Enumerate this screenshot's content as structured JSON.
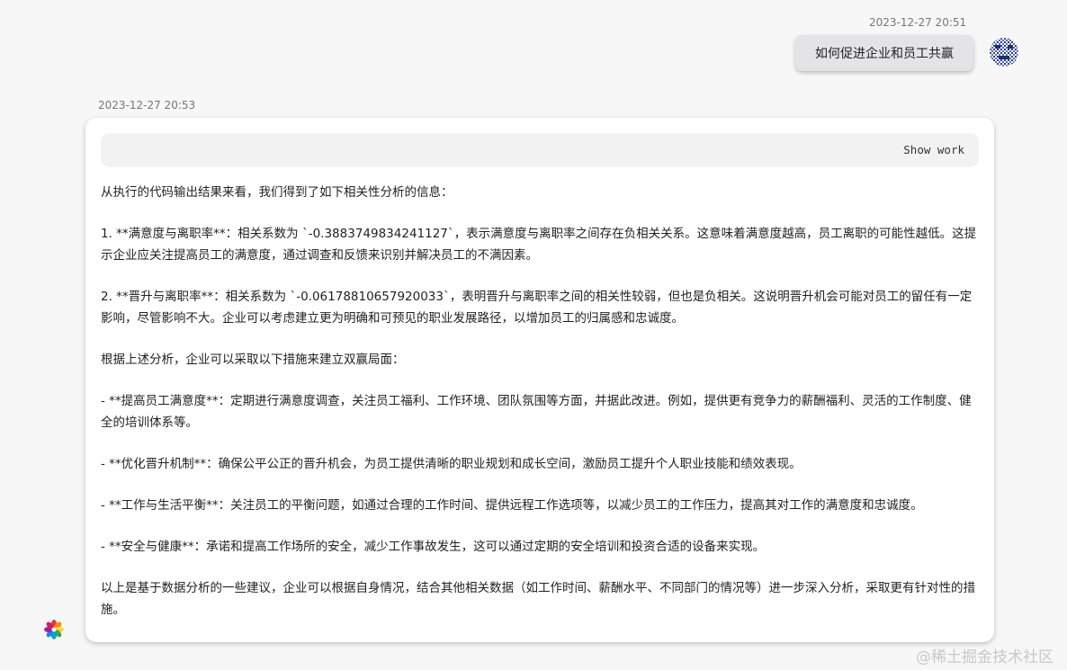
{
  "user_message": {
    "timestamp": "2023-12-27 20:51",
    "text": "如何促进企业和员工共赢"
  },
  "bot_message": {
    "timestamp": "2023-12-27 20:53",
    "show_work_label": "Show work",
    "paragraphs": [
      "从执行的代码输出结果来看，我们得到了如下相关性分析的信息：",
      "1. **满意度与离职率**：相关系数为 `-0.3883749834241127`，表示满意度与离职率之间存在负相关关系。这意味着满意度越高，员工离职的可能性越低。这提示企业应关注提高员工的满意度，通过调查和反馈来识别并解决员工的不满因素。",
      "2. **晋升与离职率**：相关系数为 `-0.06178810657920033`，表明晋升与离职率之间的相关性较弱，但也是负相关。这说明晋升机会可能对员工的留任有一定影响，尽管影响不大。企业可以考虑建立更为明确和可预见的职业发展路径，以增加员工的归属感和忠诚度。",
      "根据上述分析，企业可以采取以下措施来建立双赢局面：",
      "- **提高员工满意度**：定期进行满意度调查，关注员工福利、工作环境、团队氛围等方面，并据此改进。例如，提供更有竞争力的薪酬福利、灵活的工作制度、健全的培训体系等。",
      "- **优化晋升机制**：确保公平公正的晋升机会，为员工提供清晰的职业规划和成长空间，激励员工提升个人职业技能和绩效表现。",
      "- **工作与生活平衡**：关注员工的平衡问题，如通过合理的工作时间、提供远程工作选项等，以减少员工的工作压力，提高其对工作的满意度和忠诚度。",
      "- **安全与健康**：承诺和提高工作场所的安全，减少工作事故发生，这可以通过定期的安全培训和投资合适的设备来实现。",
      "以上是基于数据分析的一些建议，企业可以根据自身情况，结合其他相关数据（如工作时间、薪酬水平、不同部门的情况等）进一步深入分析，采取更有针对性的措施。"
    ]
  },
  "watermark": "@稀土掘金技术社区",
  "icons": {
    "user_avatar": "user-avatar-icon",
    "bot_avatar": "bot-avatar-icon"
  }
}
